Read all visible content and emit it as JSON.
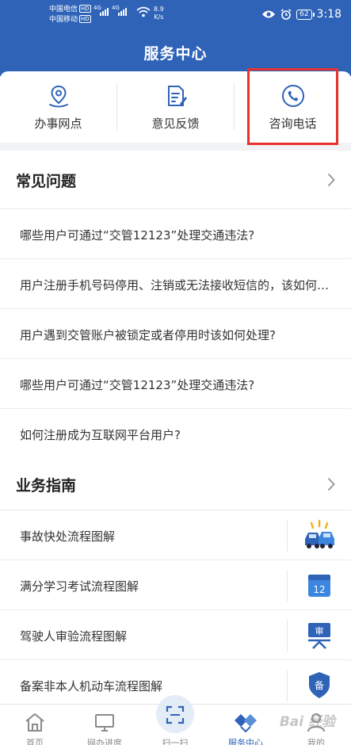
{
  "status_bar": {
    "carrier1": "中国电信",
    "carrier2": "中国移动",
    "hd": "HD",
    "net1": "4G",
    "net2": "4G",
    "speed_value": "8.9",
    "speed_unit": "K/s",
    "battery": "62",
    "time": "3:18"
  },
  "header": {
    "title": "服务中心"
  },
  "quick_actions": [
    {
      "label": "办事网点",
      "icon": "location-pin-icon"
    },
    {
      "label": "意见反馈",
      "icon": "feedback-document-icon"
    },
    {
      "label": "咨询电话",
      "icon": "phone-icon"
    }
  ],
  "faq": {
    "title": "常见问题",
    "items": [
      "哪些用户可通过“交管12123”处理交通违法?",
      "用户注册手机号码停用、注销或无法接收短信的，该如何处理？",
      "用户遇到交管账户被锁定或者停用时该如何处理?",
      "哪些用户可通过“交管12123”处理交通违法?",
      "如何注册成为互联网平台用户?"
    ]
  },
  "guide": {
    "title": "业务指南",
    "items": [
      {
        "label": "事故快处流程图解",
        "icon": "car-accident-icon"
      },
      {
        "label": "满分学习考试流程图解",
        "icon": "calendar-12-icon",
        "icon_text": "12"
      },
      {
        "label": "驾驶人审验流程图解",
        "icon": "review-sign-icon",
        "icon_text": "审"
      },
      {
        "label": "备案非本人机动车流程图解",
        "icon": "shield-badge-icon",
        "icon_text": "备"
      }
    ]
  },
  "tabbar": [
    {
      "label": "首页",
      "icon": "home-icon"
    },
    {
      "label": "网办进度",
      "icon": "monitor-icon"
    },
    {
      "label": "扫一扫",
      "icon": "scan-icon"
    },
    {
      "label": "服务中心",
      "icon": "service-diamond-icon",
      "active": true
    },
    {
      "label": "我的",
      "icon": "user-icon"
    }
  ],
  "watermark": "Bai 经验",
  "colors": {
    "brand_blue": "#2f63b8",
    "annotation_red": "#e8312f"
  }
}
